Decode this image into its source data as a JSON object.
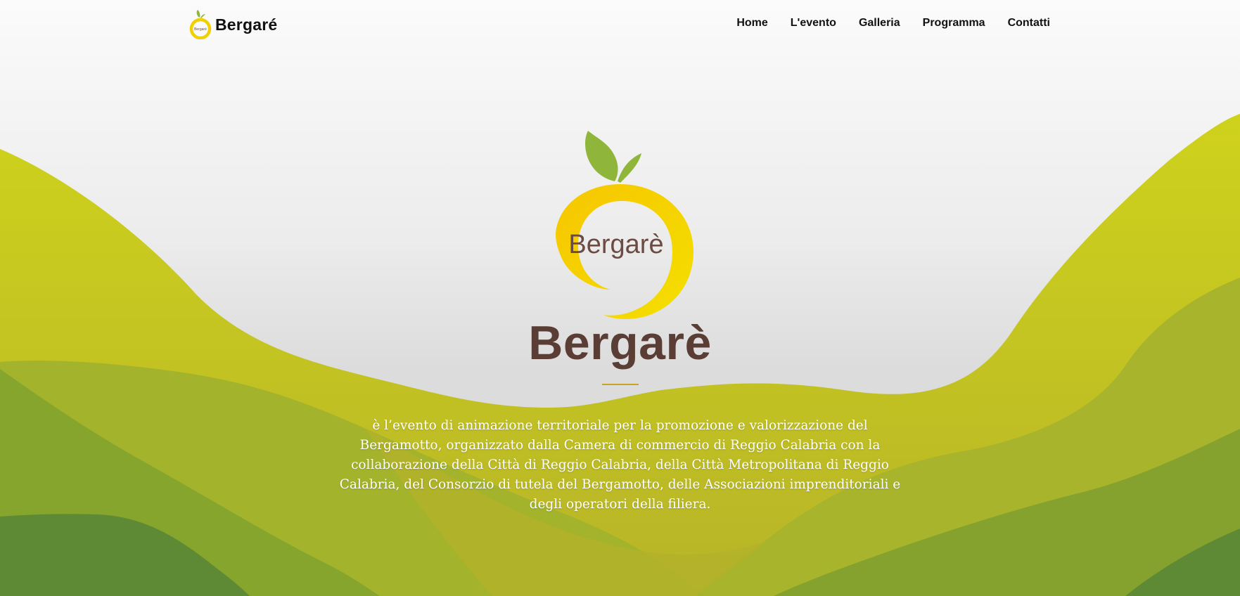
{
  "header": {
    "brand_name": "Bergaré",
    "nav": [
      {
        "label": "Home"
      },
      {
        "label": "L'evento"
      },
      {
        "label": "Galleria"
      },
      {
        "label": "Programma"
      },
      {
        "label": "Contatti"
      }
    ]
  },
  "hero": {
    "logo_text": "Bergarè",
    "title": "Bergarè",
    "description": "è l’evento di animazione territoriale per la promozione e valorizzazione del Bergamotto, organizzato dalla Camera di commercio di Reggio Calabria con la collaborazione della Città di Reggio Calabria, della Città Metropolitana di Reggio Calabria, del Consorzio di tutela del Bergamotto, delle Associazioni imprenditoriali e degli operatori della filiera."
  },
  "colors": {
    "title": "#5a3d34",
    "accent_line": "#c9a227",
    "leaf": "#8fb63a",
    "ring": "#f2cf00",
    "wave_light": "#c8c81e",
    "wave_mid": "#9fb02a",
    "wave_dark": "#5e8a35"
  }
}
